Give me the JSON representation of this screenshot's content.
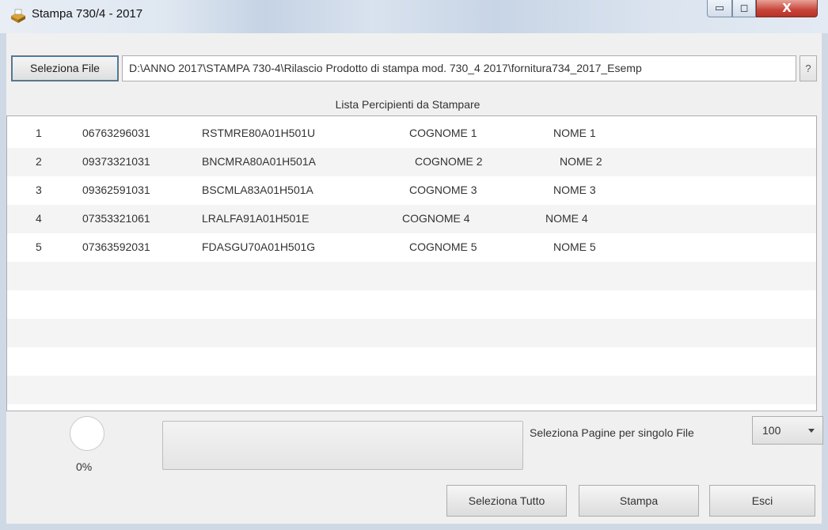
{
  "window": {
    "title": "Stampa 730/4 - 2017",
    "min_glyph": "▭",
    "max_glyph": "◻",
    "close_glyph": "X"
  },
  "file": {
    "button_label": "Seleziona File",
    "path": "D:\\ANNO 2017\\STAMPA  730-4\\Rilascio Prodotto di stampa mod. 730_4 2017\\fornitura734_2017_Esemp",
    "help_label": "?"
  },
  "list": {
    "header": "Lista Percipienti da Stampare",
    "rows": [
      {
        "num": "1",
        "code": "06763296031",
        "cf": "RSTMRE80A01H501U",
        "surname": "COGNOME 1",
        "name": "NOME 1"
      },
      {
        "num": "2",
        "code": "09373321031",
        "cf": "BNCMRA80A01H501A",
        "surname": "COGNOME 2",
        "name": "NOME 2"
      },
      {
        "num": "3",
        "code": "09362591031",
        "cf": "BSCMLA83A01H501A",
        "surname": "COGNOME 3",
        "name": "NOME 3"
      },
      {
        "num": "4",
        "code": "07353321061",
        "cf": "LRALFA91A01H501E",
        "surname": "COGNOME 4",
        "name": "NOME 4"
      },
      {
        "num": "5",
        "code": "07363592031",
        "cf": "FDASGU70A01H501G",
        "surname": "COGNOME 5",
        "name": "NOME 5"
      }
    ]
  },
  "progress": {
    "percent_label": "0%",
    "value": 0
  },
  "pages": {
    "label": "Seleziona Pagine per singolo File",
    "selected": "100"
  },
  "actions": {
    "select_all": "Seleziona Tutto",
    "print": "Stampa",
    "exit": "Esci"
  },
  "colors": {
    "progress_fill": "#06b025",
    "focus_outline": "#3c7fb1"
  }
}
